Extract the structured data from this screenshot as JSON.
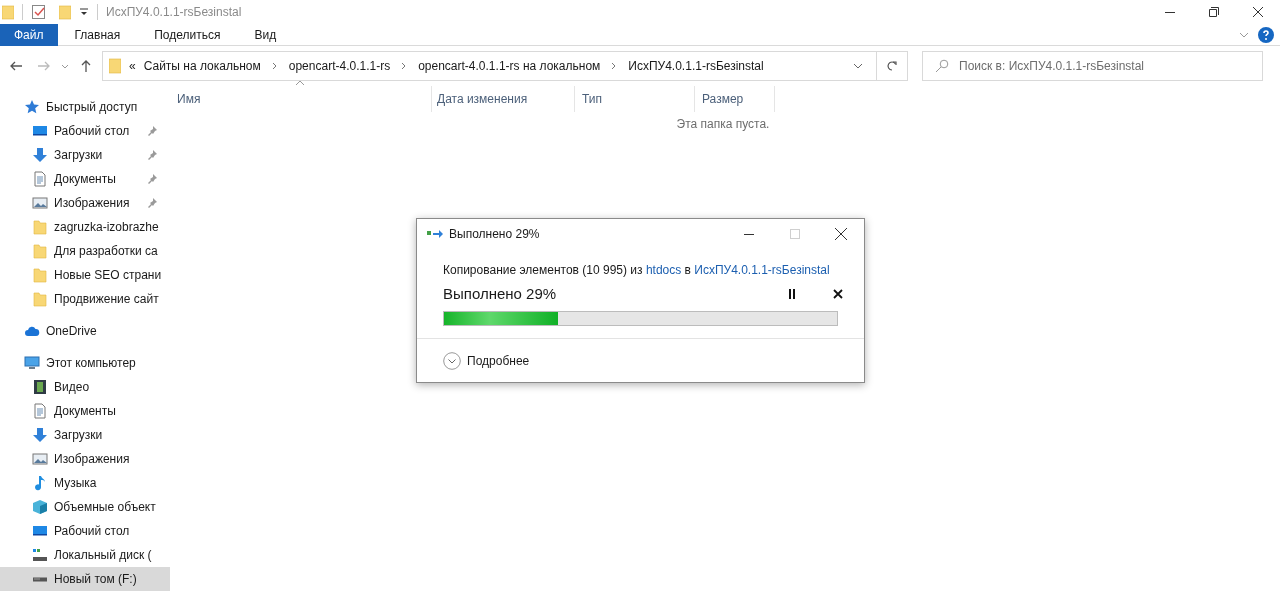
{
  "window": {
    "title": "ИсхПУ4.0.1.1-rsБезinstal"
  },
  "ribbon_tabs": [
    {
      "label": "Файл",
      "selected": true
    },
    {
      "label": "Главная",
      "selected": false
    },
    {
      "label": "Поделиться",
      "selected": false
    },
    {
      "label": "Вид",
      "selected": false
    }
  ],
  "address_bar": {
    "overflow": "«",
    "segments": [
      "Сайты на локальном",
      "opencart-4.0.1.1-rs",
      "opencart-4.0.1.1-rs на локальном",
      "ИсхПУ4.0.1.1-rsБезinstal"
    ]
  },
  "search": {
    "placeholder": "Поиск в: ИсхПУ4.0.1.1-rsБезinstal"
  },
  "navigation": [
    {
      "label": "Быстрый доступ",
      "kind": "star",
      "selected": false,
      "children": [
        {
          "label": "Рабочий стол",
          "kind": "desktop",
          "pinned": true,
          "selected": false
        },
        {
          "label": "Загрузки",
          "kind": "download",
          "pinned": true,
          "selected": false
        },
        {
          "label": "Документы",
          "kind": "document",
          "pinned": true,
          "selected": false
        },
        {
          "label": "Изображения",
          "kind": "image",
          "pinned": true,
          "selected": false
        },
        {
          "label": "zagruzka-izobrazhe",
          "kind": "folder",
          "pinned": false,
          "selected": false
        },
        {
          "label": "Для разработки са",
          "kind": "folder",
          "pinned": false,
          "selected": false
        },
        {
          "label": "Новые SEO страни",
          "kind": "folder",
          "pinned": false,
          "selected": false
        },
        {
          "label": "Продвижение сайт",
          "kind": "folder",
          "pinned": false,
          "selected": false
        }
      ]
    },
    {
      "label": "OneDrive",
      "kind": "cloud",
      "selected": false
    },
    {
      "label": "Этот компьютер",
      "kind": "computer",
      "selected": false,
      "children": [
        {
          "label": "Видео",
          "kind": "video",
          "pinned": false,
          "selected": false
        },
        {
          "label": "Документы",
          "kind": "document",
          "pinned": false,
          "selected": false
        },
        {
          "label": "Загрузки",
          "kind": "download",
          "pinned": false,
          "selected": false
        },
        {
          "label": "Изображения",
          "kind": "image",
          "pinned": false,
          "selected": false
        },
        {
          "label": "Музыка",
          "kind": "music",
          "pinned": false,
          "selected": false
        },
        {
          "label": "Объемные объект",
          "kind": "cube",
          "pinned": false,
          "selected": false
        },
        {
          "label": "Рабочий стол",
          "kind": "desktop",
          "pinned": false,
          "selected": false
        },
        {
          "label": "Локальный диск (",
          "kind": "system-disk",
          "pinned": false,
          "selected": false
        },
        {
          "label": "Новый том (F:)",
          "kind": "drive",
          "pinned": false,
          "selected": true
        }
      ]
    }
  ],
  "table": {
    "columns": [
      "Имя",
      "Дата изменения",
      "Тип",
      "Размер"
    ],
    "empty_message": "Эта папка пуста."
  },
  "dialog": {
    "title": "Выполнено 29%",
    "maximize_disabled": true,
    "description": [
      {
        "text": "Копирование элементов (10 995) из",
        "link": false
      },
      {
        "text": "htdocs",
        "link": true
      },
      {
        "text": "в",
        "link": false
      },
      {
        "text": "ИсхПУ4.0.1.1-rsБезinstal",
        "link": true
      }
    ],
    "status": "Выполнено 29%",
    "level": 0.29,
    "details": "Подробнее"
  }
}
